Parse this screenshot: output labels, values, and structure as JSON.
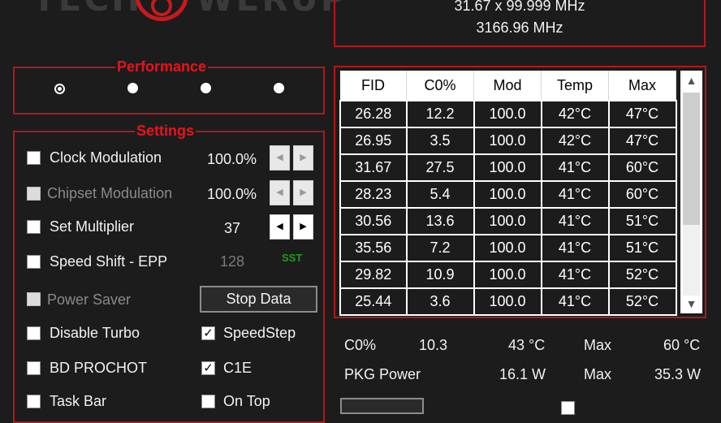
{
  "logo": {
    "text_left": "TECH",
    "text_right": "WERUP"
  },
  "frequency": {
    "line1": "31.67 x 99.999 MHz",
    "line2": "3166.96 MHz"
  },
  "performance": {
    "title": "Performance",
    "selected_index": 0,
    "options_count": 4
  },
  "settings": {
    "title": "Settings",
    "clock_modulation": {
      "label": "Clock Modulation",
      "value": "100.0%",
      "checked": false
    },
    "chipset_modulation": {
      "label": "Chipset Modulation",
      "value": "100.0%",
      "checked": false,
      "disabled": true
    },
    "set_multiplier": {
      "label": "Set Multiplier",
      "value": "37",
      "checked": false
    },
    "speed_shift": {
      "label": "Speed Shift - EPP",
      "value": "128",
      "badge": "SST",
      "checked": false
    },
    "power_saver": {
      "label": "Power Saver",
      "checked": false,
      "disabled": true
    },
    "stop_data_button": "Stop Data",
    "disable_turbo": {
      "label": "Disable Turbo",
      "checked": false
    },
    "speedstep": {
      "label": "SpeedStep",
      "checked": true
    },
    "bd_prochot": {
      "label": "BD PROCHOT",
      "checked": false
    },
    "c1e": {
      "label": "C1E",
      "checked": true
    },
    "task_bar": {
      "label": "Task Bar",
      "checked": false
    },
    "on_top": {
      "label": "On Top",
      "checked": false
    }
  },
  "table": {
    "headers": [
      "FID",
      "C0%",
      "Mod",
      "Temp",
      "Max"
    ],
    "rows": [
      [
        "26.28",
        "12.2",
        "100.0",
        "42°C",
        "47°C"
      ],
      [
        "26.95",
        "3.5",
        "100.0",
        "42°C",
        "47°C"
      ],
      [
        "31.67",
        "27.5",
        "100.0",
        "41°C",
        "60°C"
      ],
      [
        "28.23",
        "5.4",
        "100.0",
        "41°C",
        "60°C"
      ],
      [
        "30.56",
        "13.6",
        "100.0",
        "41°C",
        "51°C"
      ],
      [
        "35.56",
        "7.2",
        "100.0",
        "41°C",
        "51°C"
      ],
      [
        "29.82",
        "10.9",
        "100.0",
        "41°C",
        "52°C"
      ],
      [
        "25.44",
        "3.6",
        "100.0",
        "41°C",
        "52°C"
      ]
    ],
    "scroll_up": "▲",
    "scroll_down": "▼"
  },
  "summary": {
    "c0_label": "C0%",
    "c0_value": "10.3",
    "temp": "43 °C",
    "max_label": "Max",
    "max_temp": "60 °C",
    "pkg_label": "PKG Power",
    "pkg_value": "16.1 W",
    "pkg_max_label": "Max",
    "pkg_max": "35.3 W"
  },
  "colors": {
    "accent_red": "#c8191f",
    "background": "#1c1c1c",
    "sst_green": "#1e9d1e"
  },
  "icons": {
    "scroll_up": "chevron-up-icon",
    "scroll_down": "chevron-down-icon",
    "spin_left": "arrow-left-icon",
    "spin_right": "arrow-right-icon"
  }
}
